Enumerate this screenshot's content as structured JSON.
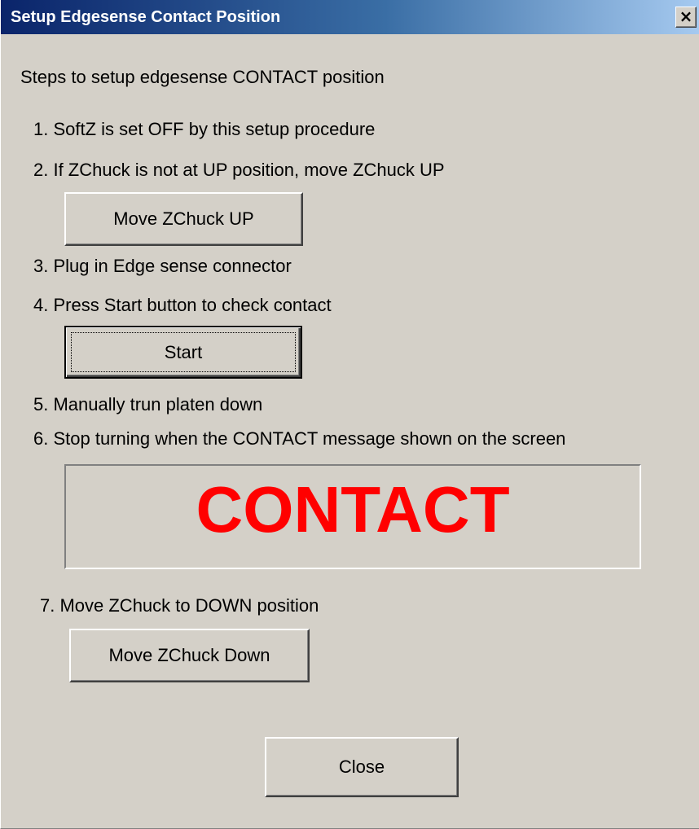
{
  "window": {
    "title": "Setup Edgesense Contact Position",
    "close_glyph": "×"
  },
  "heading": "Steps to setup edgesense CONTACT position",
  "steps": [
    "1. SoftZ is set OFF by this setup procedure",
    "2. If ZChuck is not at UP position,  move ZChuck UP",
    "3. Plug in Edge sense connector",
    "4. Press Start button to check contact",
    "5. Manually trun platen down",
    "6. Stop turning when the CONTACT message shown on the screen",
    "7. Move ZChuck to DOWN position"
  ],
  "buttons": {
    "move_up": "Move ZChuck UP",
    "start": "Start",
    "move_down": "Move ZChuck Down",
    "close": "Close"
  },
  "contact_status": {
    "text": "CONTACT",
    "color": "#ff0000"
  },
  "colors": {
    "background": "#d4d0c8",
    "titlebar_start": "#0a246a",
    "titlebar_end": "#a6caf0"
  }
}
